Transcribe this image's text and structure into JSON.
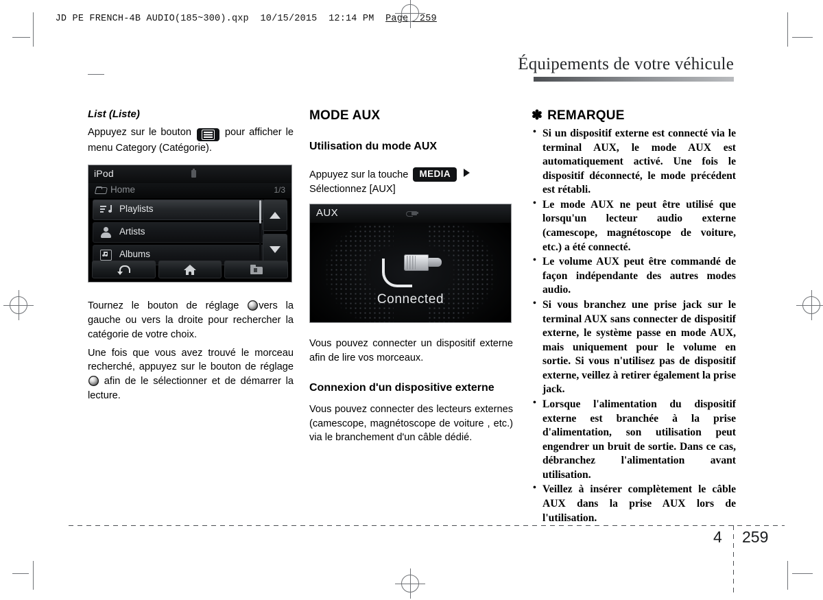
{
  "print_header": {
    "file": "JD PE FRENCH-4B AUDIO(185~300).qxp",
    "date": "10/15/2015",
    "time": "12:14 PM",
    "page_label": "Page  259"
  },
  "section": {
    "title": "Équipements de votre véhicule"
  },
  "left_column": {
    "heading": "List (Liste)",
    "intro_before": "Appuyez sur le bouton",
    "intro_after": "pour afficher le menu Category (Catégorie).",
    "button_icon": "list-icon",
    "device": {
      "title": "iPod",
      "battery_icon": "battery-icon",
      "breadcrumb": "Home",
      "breadcrumb_icon": "folder-open-icon",
      "page_indicator": "1/3",
      "items": [
        {
          "label": "Playlists",
          "icon": "playlist-icon",
          "selected": true
        },
        {
          "label": "Artists",
          "icon": "person-icon",
          "selected": false
        },
        {
          "label": "Albums",
          "icon": "album-icon",
          "selected": false
        }
      ],
      "scroll_up_icon": "triangle-up-icon",
      "scroll_down_icon": "triangle-down-icon",
      "nav": [
        {
          "icon": "back-arrow-icon"
        },
        {
          "icon": "home-icon"
        },
        {
          "icon": "folder-up-icon"
        }
      ]
    },
    "para_1_a": "Tournez le bouton de réglage",
    "para_1_b": "vers la gauche ou vers la droite pour rechercher la catégorie de votre choix.",
    "para_2_a": "Une fois que vous avez trouvé le morceau recherché, appuyez sur le bouton de réglage",
    "para_2_b": "afin de le sélectionner et de démarrer la lecture.",
    "knob_icon": "rotary-knob-icon"
  },
  "mid_column": {
    "heading_1": "MODE AUX",
    "heading_2": "Utilisation du mode AUX",
    "press_before": "Appuyez sur la touche",
    "media_key": "MEDIA",
    "arrow_icon": "triangle-right-icon",
    "press_after": "Sélectionnez [AUX]",
    "device": {
      "title": "AUX",
      "header_icon": "plug-icon",
      "center_icon": "aux-plug-icon",
      "caption": "Connected"
    },
    "para_1": "Vous pouvez connecter un dispositif externe afin de lire vos morceaux.",
    "heading_3": "Connexion d'un dispositive externe",
    "para_2": "Vous pouvez connecter des lecteurs externes (camescope, magnétoscope de voiture , etc.) via le branchement d'un câble dédié."
  },
  "right_column": {
    "note_asterisk": "✽",
    "note_title": "REMARQUE",
    "notes": [
      "Si un dispositif externe est connecté via le terminal AUX, le mode AUX est automatiquement activé. Une fois le dispositif déconnecté, le mode précédent est rétabli.",
      "Le mode AUX ne peut être utilisé que lorsqu'un lecteur audio externe (camescope, magnétoscope de voiture, etc.) a été connecté.",
      "Le volume AUX peut être commandé de façon indépendante des autres modes audio.",
      "Si vous branchez une prise jack sur le terminal AUX sans connecter de dispositif externe, le système passe en mode AUX, mais uniquement pour le volume en sortie. Si vous n'utilisez pas de dispositif externe, veillez à retirer également la prise jack.",
      "Lorsque l'alimentation du dispositif externe est branchée à la prise d'alimentation, son utilisation peut engendrer un bruit de sortie. Dans ce cas, débranchez l'alimentation avant utilisation.",
      "Veillez à insérer complètement le câble AUX dans la prise AUX lors de l'utilisation."
    ]
  },
  "footer": {
    "chapter": "4",
    "page": "259"
  }
}
